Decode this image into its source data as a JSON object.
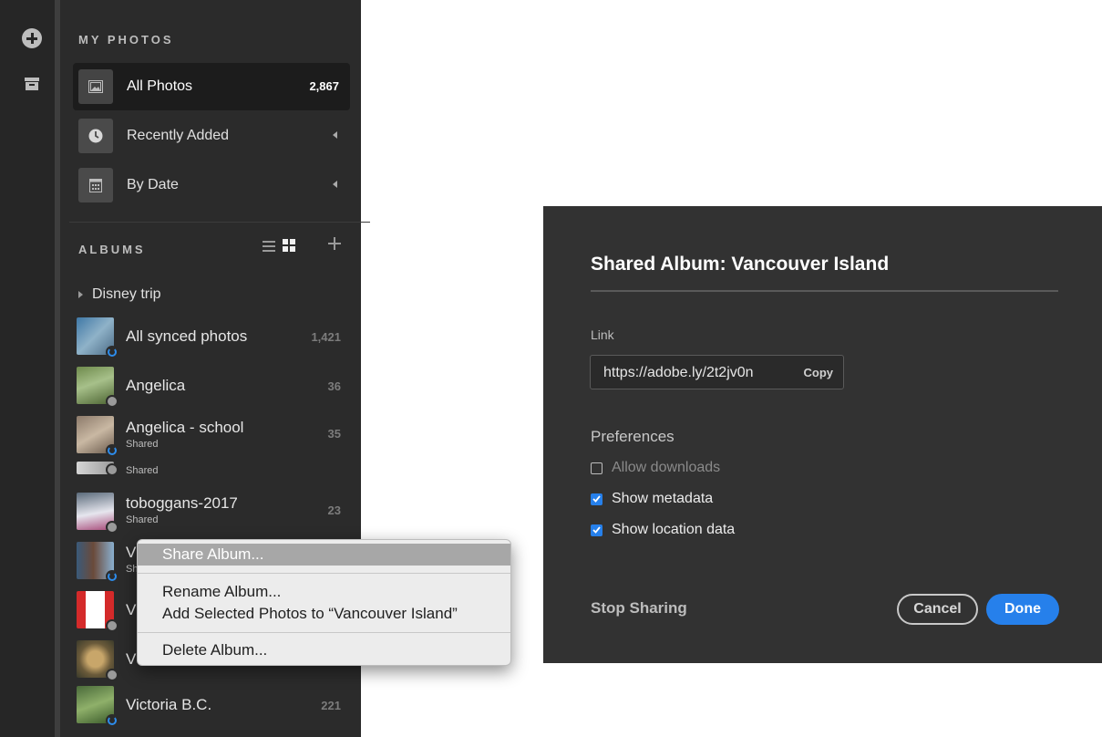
{
  "sidebar": {
    "my_photos_label": "MY PHOTOS",
    "nav": [
      {
        "label": "All Photos",
        "count": "2,867",
        "icon": "image-icon"
      },
      {
        "label": "Recently Added",
        "icon": "clock-icon"
      },
      {
        "label": "By Date",
        "icon": "calendar-icon"
      }
    ],
    "albums_label": "ALBUMS",
    "folder": "Disney trip",
    "albums": [
      {
        "name": "All synced photos",
        "count": "1,421",
        "status": "syncing"
      },
      {
        "name": "Angelica",
        "count": "36",
        "status": "synced"
      },
      {
        "name": "Angelica - school",
        "sub": "Shared",
        "count": "35",
        "status": "syncing"
      },
      {
        "name": "",
        "sub": "Shared",
        "status": "synced"
      },
      {
        "name": "toboggans-2017",
        "sub": "Shared",
        "count": "23",
        "status": "synced"
      },
      {
        "name": "V",
        "sub": "Sh",
        "status": "syncing"
      },
      {
        "name": "V",
        "status": "synced"
      },
      {
        "name": "V",
        "status": "synced"
      },
      {
        "name": "Victoria B.C.",
        "count": "221",
        "status": "syncing"
      }
    ]
  },
  "context_menu": {
    "share": "Share Album...",
    "rename": "Rename Album...",
    "add_selected": "Add Selected Photos to “Vancouver Island”",
    "delete": "Delete Album..."
  },
  "dialog": {
    "title": "Shared Album: Vancouver Island",
    "link_label": "Link",
    "link_url": "https://adobe.ly/2t2jv0n",
    "copy": "Copy",
    "preferences_label": "Preferences",
    "options": [
      {
        "label": "Allow downloads",
        "checked": false
      },
      {
        "label": "Show metadata",
        "checked": true
      },
      {
        "label": "Show location data",
        "checked": true
      }
    ],
    "stop_sharing": "Stop Sharing",
    "cancel": "Cancel",
    "done": "Done"
  },
  "colors": {
    "accent": "#2680eb",
    "panel": "#2b2b2b",
    "dialog": "#323232"
  }
}
